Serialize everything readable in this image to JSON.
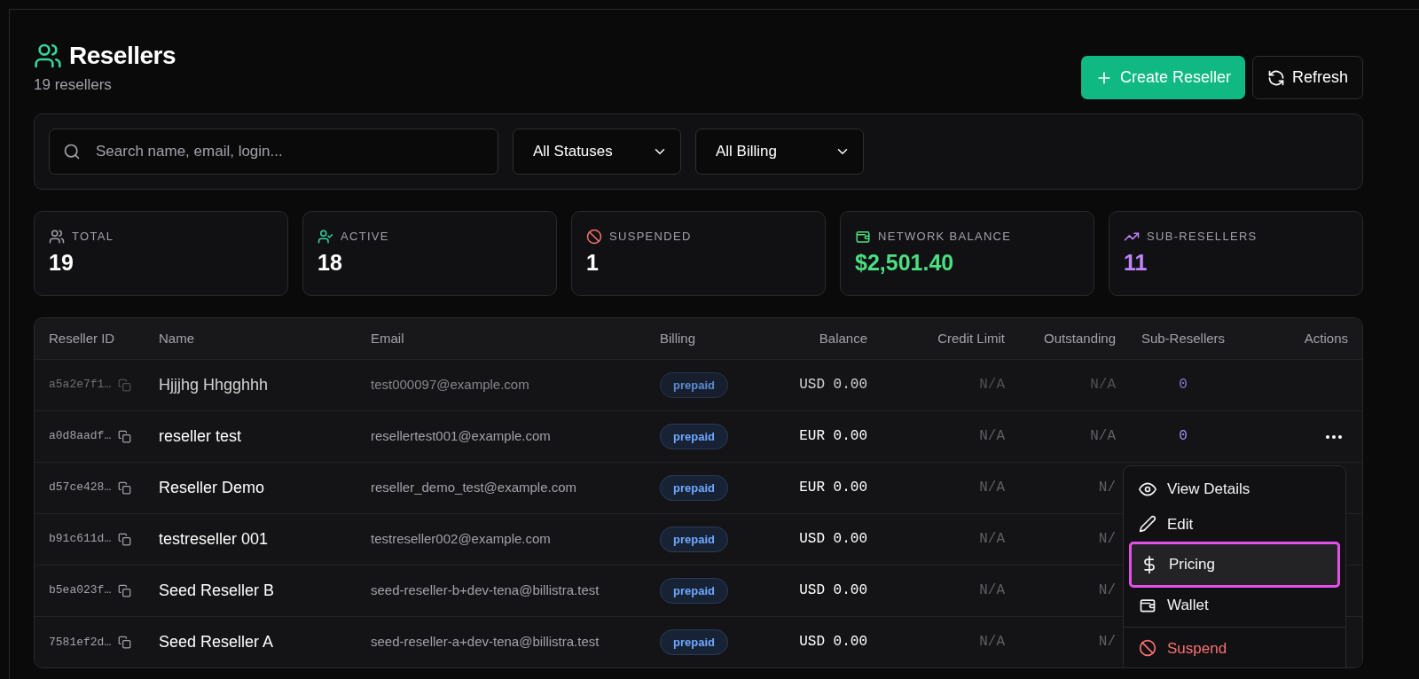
{
  "header": {
    "title": "Resellers",
    "subtitle": "19 resellers",
    "buttons": [
      {
        "kind": "create",
        "label": "Create Reseller"
      },
      {
        "kind": "refresh",
        "label": "Refresh"
      }
    ]
  },
  "filters": {
    "search": {
      "placeholder": "Search name, email, login..."
    },
    "selects": [
      {
        "value": "All Statuses"
      },
      {
        "value": "All Billing"
      }
    ]
  },
  "stats": [
    {
      "kind": "users",
      "label": "TOTAL",
      "value": "19",
      "color": "#a1a1aa",
      "value_accent": false
    },
    {
      "kind": "user-check",
      "label": "ACTIVE",
      "value": "18",
      "color": "#34d399",
      "value_accent": false
    },
    {
      "kind": "ban",
      "label": "SUSPENDED",
      "value": "1",
      "color": "#f87171",
      "value_accent": false
    },
    {
      "kind": "wallet",
      "label": "NETWORK BALANCE",
      "value": "$2,501.40",
      "color": "#4ade80",
      "value_accent": true
    },
    {
      "kind": "trend",
      "label": "SUB-RESELLERS",
      "value": "11",
      "color": "#c084fc",
      "value_accent": true
    }
  ],
  "table": {
    "columns": [
      "Reseller ID",
      "Name",
      "Email",
      "Billing",
      "Balance",
      "Credit Limit",
      "Outstanding",
      "Sub-Resellers",
      "Actions"
    ],
    "rows": [
      {
        "id": "a5a2e7f1…",
        "name": "Hjjjhg Hhgghhh",
        "email": "test000097@example.com",
        "billing": "prepaid",
        "balance": "USD 0.00",
        "credit_limit": "N/A",
        "outstanding": "N/A",
        "sub_resellers": "0",
        "menu_button": false,
        "faded": true
      },
      {
        "id": "a0d8aadf…",
        "name": "reseller test",
        "email": "resellertest001@example.com",
        "billing": "prepaid",
        "balance": "EUR 0.00",
        "credit_limit": "N/A",
        "outstanding": "N/A",
        "sub_resellers": "0",
        "menu_button": true,
        "faded": false
      },
      {
        "id": "d57ce428…",
        "name": "Reseller Demo",
        "email": "reseller_demo_test@example.com",
        "billing": "prepaid",
        "balance": "EUR 0.00",
        "credit_limit": "N/A",
        "outstanding": "N/",
        "faded": false
      },
      {
        "id": "b91c611d…",
        "name": "testreseller 001",
        "email": "testreseller002@example.com",
        "billing": "prepaid",
        "balance": "USD 0.00",
        "credit_limit": "N/A",
        "outstanding": "N/",
        "faded": false
      },
      {
        "id": "b5ea023f…",
        "name": "Seed Reseller B",
        "email": "seed-reseller-b+dev-tena@billistra.test",
        "billing": "prepaid",
        "balance": "USD 0.00",
        "credit_limit": "N/A",
        "outstanding": "N/",
        "faded": false
      },
      {
        "id": "7581ef2d…",
        "name": "Seed Reseller A",
        "email": "seed-reseller-a+dev-tena@billistra.test",
        "billing": "prepaid",
        "balance": "USD 0.00",
        "credit_limit": "N/A",
        "outstanding": "N/",
        "faded": false
      }
    ]
  },
  "menu": {
    "items": [
      {
        "kind": "view",
        "label": "View Details",
        "selected": false,
        "annotated": false
      },
      {
        "kind": "edit",
        "label": "Edit",
        "selected": false,
        "annotated": false
      },
      {
        "kind": "pricing",
        "label": "Pricing",
        "selected": true,
        "annotated": true
      },
      {
        "kind": "wallet",
        "label": "Wallet",
        "selected": false,
        "annotated": false
      },
      {
        "kind": "suspend",
        "label": "Suspend",
        "selected": false,
        "annotated": false
      }
    ]
  }
}
